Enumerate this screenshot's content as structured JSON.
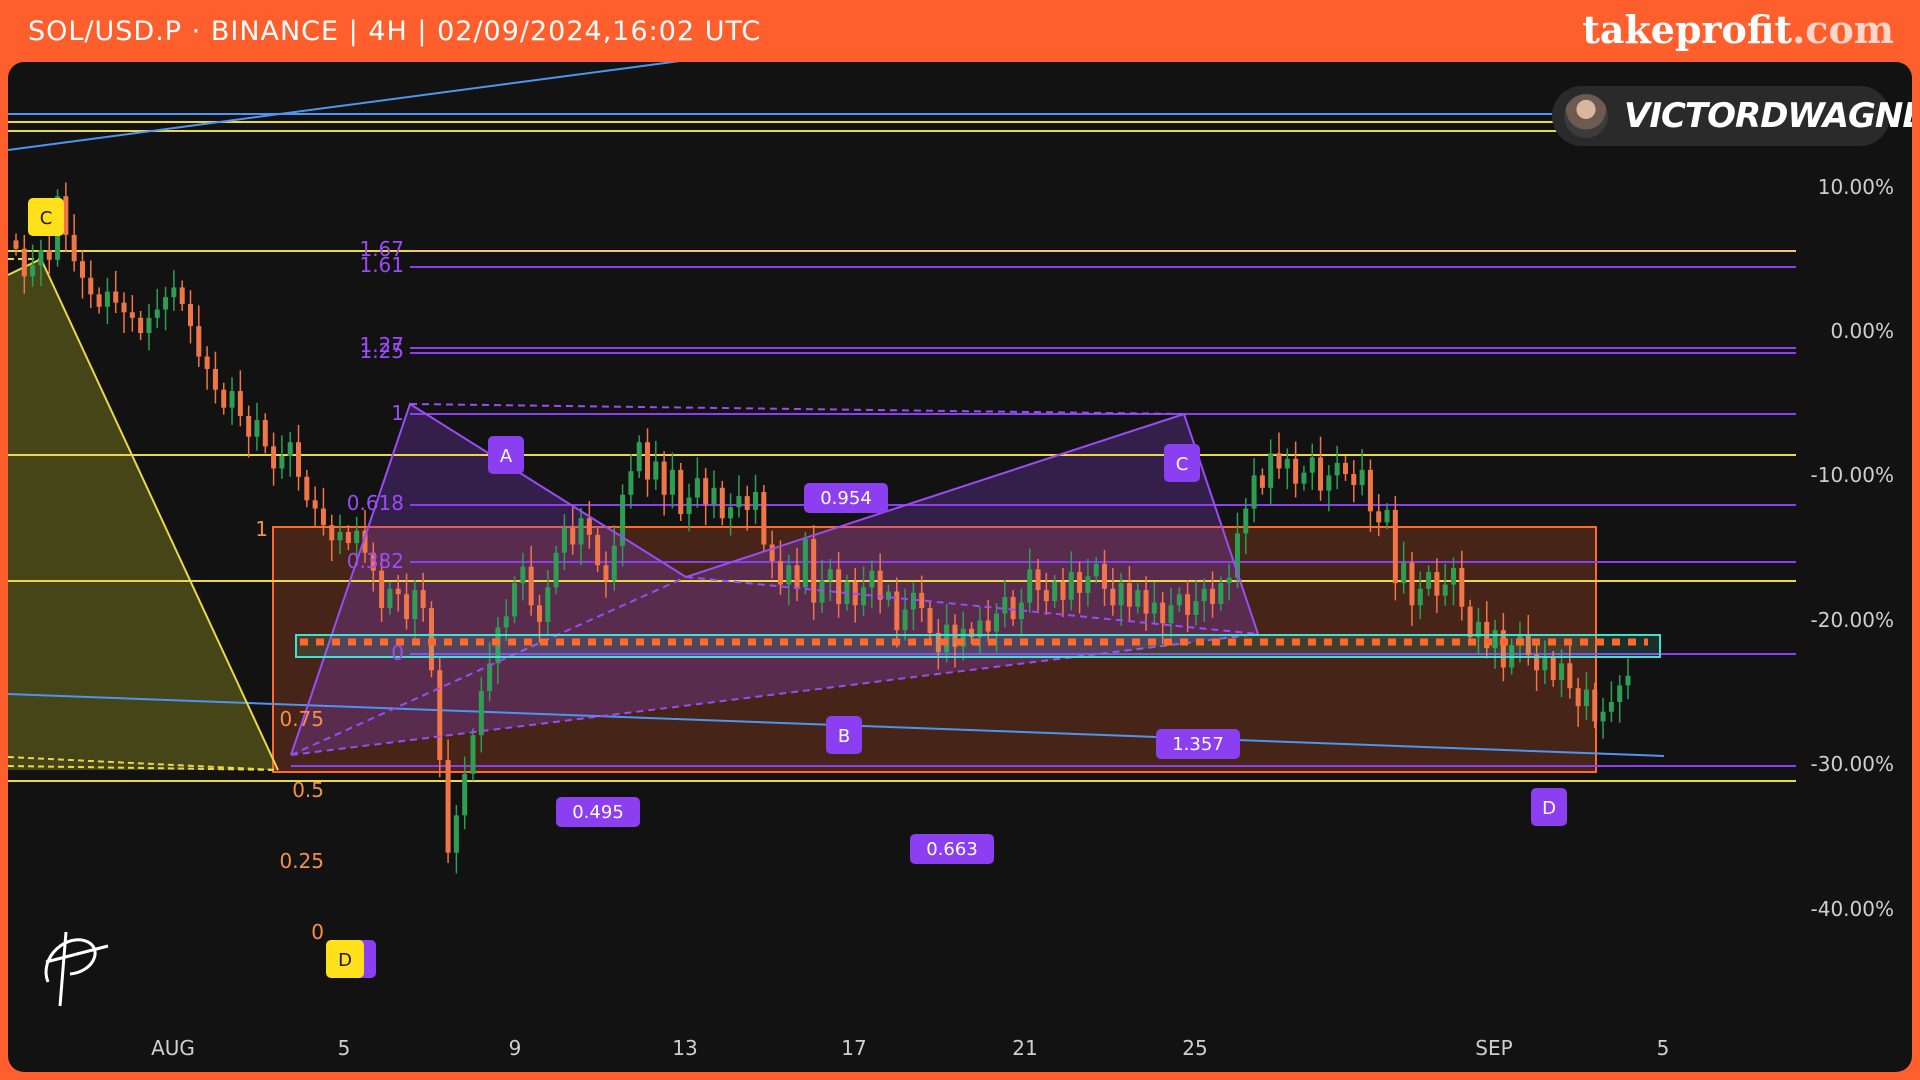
{
  "header": {
    "title": "SOL/USD.P · BINANCE | 4H | 02/09/2024,16:02 UTC",
    "brand": "takeprofit",
    "brand_suffix": ".com"
  },
  "author": {
    "name": "VICTORDWAGNER"
  },
  "chart_data": {
    "type": "candlestick",
    "symbol": "SOL/USD.P",
    "exchange": "BINANCE",
    "timeframe": "4H",
    "x_tick_labels": [
      "AUG",
      "5",
      "9",
      "13",
      "17",
      "21",
      "25",
      "SEP",
      "5"
    ],
    "y_tick_labels": [
      "10.00%",
      "0.00%",
      "-10.00%",
      "-20.00%",
      "-30.00%",
      "-40.00%"
    ],
    "y_ticks": [
      10,
      0,
      -10,
      -20,
      -30,
      -40
    ],
    "ylim": [
      -45.6,
      14.5
    ],
    "scale": "percent",
    "grid": false,
    "candles_close_pct": [
      3.0,
      1.0,
      1.8,
      2.9,
      2.2,
      6.8,
      4.0,
      2.1,
      0.9,
      -0.3,
      -1.2,
      -0.1,
      -0.9,
      -1.6,
      -2.0,
      -3.1,
      -2.0,
      -1.4,
      -0.5,
      0.2,
      -1.0,
      -2.6,
      -4.8,
      -5.7,
      -7.2,
      -8.5,
      -7.3,
      -9.1,
      -10.6,
      -9.4,
      -11.3,
      -12.9,
      -12.0,
      -11.0,
      -13.5,
      -15.2,
      -15.8,
      -17.0,
      -18.1,
      -17.5,
      -18.3,
      -17.4,
      -19.0,
      -20.3,
      -23.0,
      -21.6,
      -22.0,
      -23.8,
      -21.7,
      -23.0,
      -27.5,
      -34.0,
      -40.7,
      -38.0,
      -35.0,
      -32.2,
      -29.0,
      -27.0,
      -24.4,
      -23.6,
      -21.2,
      -20.0,
      -22.8,
      -24.0,
      -21.5,
      -19.0,
      -17.2,
      -18.4,
      -16.5,
      -17.7,
      -19.9,
      -21.0,
      -18.5,
      -14.8,
      -13.1,
      -11.0,
      -13.7,
      -12.4,
      -14.8,
      -13.0,
      -16.2,
      -15.0,
      -13.6,
      -15.5,
      -14.3,
      -16.5,
      -15.7,
      -14.9,
      -15.9,
      -14.6,
      -18.4,
      -19.6,
      -21.3,
      -19.9,
      -21.5,
      -18.0,
      -22.6,
      -21.0,
      -20.2,
      -22.7,
      -21.1,
      -22.8,
      -21.5,
      -20.3,
      -22.4,
      -21.8,
      -24.6,
      -23.1,
      -21.9,
      -23.0,
      -24.8,
      -26.2,
      -24.2,
      -25.8,
      -24.5,
      -25.1,
      -23.9,
      -24.7,
      -23.4,
      -22.2,
      -23.8,
      -22.6,
      -20.2,
      -21.7,
      -22.5,
      -21.1,
      -22.4,
      -20.4,
      -21.9,
      -20.7,
      -19.8,
      -21.6,
      -22.8,
      -21.2,
      -22.9,
      -21.7,
      -23.4,
      -22.6,
      -24.1,
      -22.8,
      -22.0,
      -23.5,
      -22.5,
      -21.6,
      -22.7,
      -21.2,
      -20.8,
      -17.6,
      -15.8,
      -13.4,
      -14.3,
      -11.8,
      -12.9,
      -12.2,
      -14.0,
      -13.2,
      -12.1,
      -14.5,
      -13.4,
      -12.5,
      -13.3,
      -14.1,
      -13.0,
      -16.0,
      -16.8,
      -15.9,
      -21.2,
      -19.7,
      -22.8,
      -21.6,
      -20.4,
      -22.1,
      -21.3,
      -20.1,
      -22.9,
      -25.1,
      -24.0,
      -25.9,
      -24.6,
      -27.3,
      -25.7,
      -25.0,
      -26.4,
      -27.5,
      -26.6,
      -28.2,
      -27.0,
      -28.8,
      -30.1,
      -28.9,
      -31.2,
      -30.5,
      -29.8,
      -28.6,
      -27.9
    ]
  },
  "harmonic_pattern": {
    "point_labels": [
      "A",
      "B",
      "C",
      "D"
    ],
    "ratio_labels": [
      "0.954",
      "1.357",
      "0.495",
      "0.663"
    ],
    "fib_level_labels": [
      "1.67",
      "1.61",
      "1.27",
      "1.25",
      "1",
      "0.618",
      "0.382",
      "0"
    ]
  },
  "left_pattern": {
    "point_labels": [
      "C",
      "D"
    ],
    "fib_level_labels": [
      "1",
      "0.75",
      "0.5",
      "0.25",
      "0"
    ]
  },
  "colors": {
    "background": "#121212",
    "frame": "#ff5f2d",
    "up_candle": "#2e9e55",
    "down_candle": "#f0764a",
    "pattern_purple": "#8b3ff0",
    "fib_yellow": "#e9d84a",
    "zone_orange": "#ff6a2c",
    "teal": "#43e0d0",
    "trend_blue": "#3f8ff0"
  }
}
